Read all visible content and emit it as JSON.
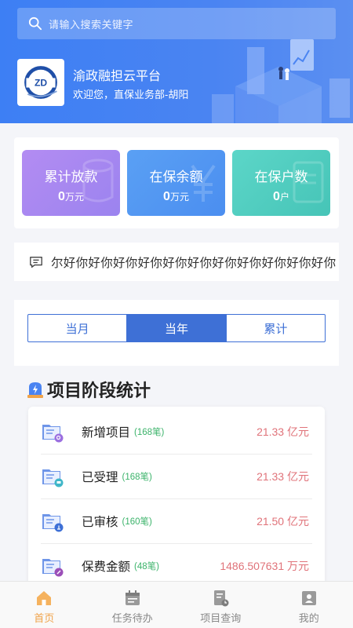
{
  "search": {
    "placeholder": "请输入搜索关键字",
    "icon": "search-icon"
  },
  "header": {
    "title": "渝政融担云平台",
    "welcome": "欢迎您，直保业务部-胡阳",
    "logo_text": "ZD"
  },
  "stats": [
    {
      "label": "累计放款",
      "value": "0",
      "unit": "万元",
      "color": "#a78af1"
    },
    {
      "label": "在保余额",
      "value": "0",
      "unit": "万元",
      "color": "#4f95f2"
    },
    {
      "label": "在保户数",
      "value": "0",
      "unit": "户",
      "color": "#4fcdbf"
    }
  ],
  "notice": {
    "icon": "message-icon",
    "text": "尔好你好你好你好你好你好你好你好你好你好你好你"
  },
  "period_tabs": {
    "items": [
      "当月",
      "当年",
      "累计"
    ],
    "active_index": 1
  },
  "section": {
    "title": "项目阶段统计",
    "icon": "lightning-badge-icon"
  },
  "stages": [
    {
      "name": "新增项目",
      "count": "(168笔)",
      "amount": "21.33 亿元",
      "icon": "folder-search-icon",
      "badge_color": "#9b6fe0"
    },
    {
      "name": "已受理",
      "count": "(168笔)",
      "amount": "21.33 亿元",
      "icon": "folder-cart-icon",
      "badge_color": "#3fb6c8"
    },
    {
      "name": "已审核",
      "count": "(160笔)",
      "amount": "21.50 亿元",
      "icon": "folder-check-icon",
      "badge_color": "#3e70d6"
    },
    {
      "name": "保费金额",
      "count": "(48笔)",
      "amount": "1486.507631 万元",
      "icon": "folder-money-icon",
      "badge_color": "#9b4fb8"
    }
  ],
  "tabbar": {
    "items": [
      {
        "label": "首页",
        "icon": "home-icon",
        "active": true
      },
      {
        "label": "任务待办",
        "icon": "calendar-icon",
        "active": false
      },
      {
        "label": "项目查询",
        "icon": "document-clock-icon",
        "active": false
      },
      {
        "label": "我的",
        "icon": "user-card-icon",
        "active": false
      }
    ],
    "active_color": "#f0a34a"
  },
  "colors": {
    "brand_blue": "#3e70d6",
    "amount_red": "#e0737a",
    "count_green": "#3bb36a"
  }
}
